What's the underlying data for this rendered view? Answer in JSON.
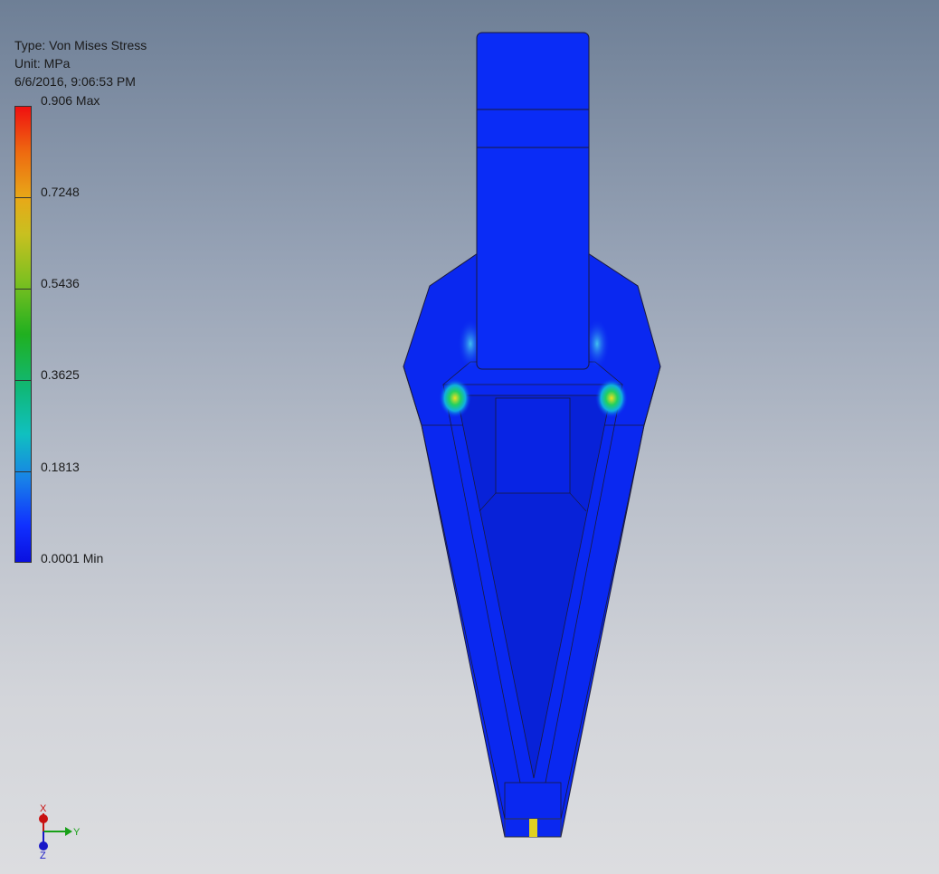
{
  "result": {
    "type_label": "Type: Von Mises Stress",
    "unit_label": "Unit: MPa",
    "timestamp": "6/6/2016, 9:06:53 PM"
  },
  "legend": {
    "ticks": [
      {
        "label": "0.906 Max"
      },
      {
        "label": "0.7248"
      },
      {
        "label": "0.5436"
      },
      {
        "label": "0.3625"
      },
      {
        "label": "0.1813"
      },
      {
        "label": "0.0001 Min"
      }
    ],
    "colors": {
      "max": "#f01010",
      "min": "#0a10e0"
    }
  },
  "triad": {
    "x": "X",
    "y": "Y",
    "z": "Z"
  },
  "model_colors": {
    "body": "#0a28f0",
    "body_dark": "#0820d8",
    "edge": "#1a1a3a",
    "hotspot": "#e8e020"
  }
}
